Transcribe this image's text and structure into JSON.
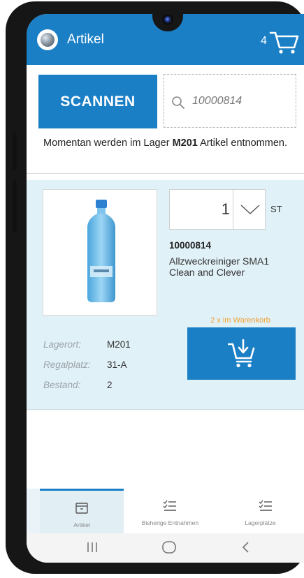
{
  "appbar": {
    "title": "Artikel",
    "cart_count": "4",
    "logo_icon": "app-logo-icon",
    "cart_icon": "shopping-cart-icon",
    "color": "#1b7fc6"
  },
  "scan": {
    "button_label": "SCANNEN",
    "search_value": "10000814",
    "search_icon": "search-icon"
  },
  "info": {
    "prefix": "Momentan werden im Lager ",
    "lager": "M201",
    "suffix": " Artikel entnommen."
  },
  "product": {
    "quantity": "1",
    "unit": "ST",
    "article_number": "10000814",
    "name": "Allzweckreiniger SMA1 Clean and Clever",
    "meta": [
      {
        "key": "Lagerort:",
        "value": "M201"
      },
      {
        "key": "Regalplatz:",
        "value": "31-A"
      },
      {
        "key": "Bestand:",
        "value": "2"
      }
    ],
    "in_cart_text": "2 x im Warenkorb",
    "in_cart_color": "#f0a030",
    "add_to_cart_icon": "add-to-cart-icon"
  },
  "tabs": [
    {
      "label": "Artikel",
      "icon": "archive-box-icon",
      "active": true
    },
    {
      "label": "Bisherige Entnahmen",
      "icon": "checklist-icon",
      "active": false
    },
    {
      "label": "Lagerplätze",
      "icon": "checklist-icon",
      "active": false
    }
  ],
  "system_nav": [
    "recent-apps-icon",
    "home-icon",
    "back-icon"
  ]
}
